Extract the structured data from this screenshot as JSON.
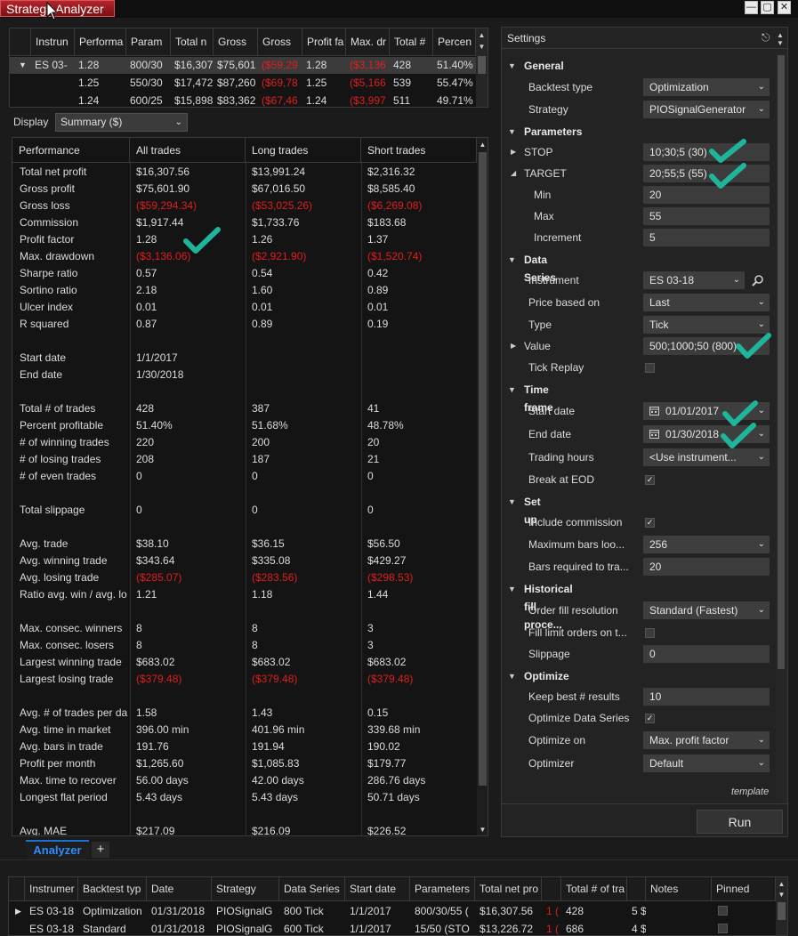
{
  "window": {
    "title": "Strategy Analyzer",
    "controls": [
      "minimize",
      "maximize",
      "close"
    ]
  },
  "top_grid": {
    "columns": [
      "Instrun",
      "Performa",
      "Param",
      "Total n",
      "Gross",
      "Gross",
      "Profit fa",
      "Max. dr",
      "Total #",
      "Percen"
    ],
    "rows": [
      {
        "instrument": "ES 03-",
        "perf": "1.28",
        "param": "800/30",
        "total_net": "$16,307",
        "gross_profit": "$75,601",
        "gross_loss": "($59,29",
        "profit_factor": "1.28",
        "max_dd": "($3,136",
        "total_trades": "428",
        "percent": "51.40%"
      },
      {
        "instrument": "",
        "perf": "1.25",
        "param": "550/30",
        "total_net": "$17,472",
        "gross_profit": "$87,260",
        "gross_loss": "($69,78",
        "profit_factor": "1.25",
        "max_dd": "($5,166",
        "total_trades": "539",
        "percent": "55.47%"
      },
      {
        "instrument": "",
        "perf": "1.24",
        "param": "600/25",
        "total_net": "$15,898",
        "gross_profit": "$83,362",
        "gross_loss": "($67,46",
        "profit_factor": "1.24",
        "max_dd": "($3,997",
        "total_trades": "511",
        "percent": "49.71%"
      }
    ]
  },
  "display": {
    "label": "Display",
    "selected": "Summary ($)"
  },
  "summary": {
    "headers": [
      "Performance",
      "All trades",
      "Long trades",
      "Short trades"
    ],
    "rows": [
      {
        "label": "Total net profit",
        "all": "$16,307.56",
        "long": "$13,991.24",
        "short": "$2,316.32",
        "neg": false
      },
      {
        "label": "Gross profit",
        "all": "$75,601.90",
        "long": "$67,016.50",
        "short": "$8,585.40",
        "neg": false
      },
      {
        "label": "Gross loss",
        "all": "($59,294.34)",
        "long": "($53,025.26)",
        "short": "($6,269.08)",
        "neg": true
      },
      {
        "label": "Commission",
        "all": "$1,917.44",
        "long": "$1,733.76",
        "short": "$183.68",
        "neg": false
      },
      {
        "label": "Profit factor",
        "all": "1.28",
        "long": "1.26",
        "short": "1.37",
        "neg": false
      },
      {
        "label": "Max. drawdown",
        "all": "($3,136.06)",
        "long": "($2,921.90)",
        "short": "($1,520.74)",
        "neg": true
      },
      {
        "label": "Sharpe ratio",
        "all": "0.57",
        "long": "0.54",
        "short": "0.42",
        "neg": false
      },
      {
        "label": "Sortino ratio",
        "all": "2.18",
        "long": "1.60",
        "short": "0.89",
        "neg": false
      },
      {
        "label": "Ulcer index",
        "all": "0.01",
        "long": "0.01",
        "short": "0.01",
        "neg": false
      },
      {
        "label": "R squared",
        "all": "0.87",
        "long": "0.89",
        "short": "0.19",
        "neg": false
      },
      {
        "label": "",
        "all": "",
        "long": "",
        "short": "",
        "neg": false
      },
      {
        "label": "Start date",
        "all": "1/1/2017",
        "long": "",
        "short": "",
        "neg": false
      },
      {
        "label": "End date",
        "all": "1/30/2018",
        "long": "",
        "short": "",
        "neg": false
      },
      {
        "label": "",
        "all": "",
        "long": "",
        "short": "",
        "neg": false
      },
      {
        "label": "Total # of trades",
        "all": "428",
        "long": "387",
        "short": "41",
        "neg": false
      },
      {
        "label": "Percent profitable",
        "all": "51.40%",
        "long": "51.68%",
        "short": "48.78%",
        "neg": false
      },
      {
        "label": "# of winning trades",
        "all": "220",
        "long": "200",
        "short": "20",
        "neg": false
      },
      {
        "label": "# of losing trades",
        "all": "208",
        "long": "187",
        "short": "21",
        "neg": false
      },
      {
        "label": "# of even trades",
        "all": "0",
        "long": "0",
        "short": "0",
        "neg": false
      },
      {
        "label": "",
        "all": "",
        "long": "",
        "short": "",
        "neg": false
      },
      {
        "label": "Total slippage",
        "all": "0",
        "long": "0",
        "short": "0",
        "neg": false
      },
      {
        "label": "",
        "all": "",
        "long": "",
        "short": "",
        "neg": false
      },
      {
        "label": "Avg. trade",
        "all": "$38.10",
        "long": "$36.15",
        "short": "$56.50",
        "neg": false
      },
      {
        "label": "Avg. winning trade",
        "all": "$343.64",
        "long": "$335.08",
        "short": "$429.27",
        "neg": false
      },
      {
        "label": "Avg. losing trade",
        "all": "($285.07)",
        "long": "($283.56)",
        "short": "($298.53)",
        "neg": true
      },
      {
        "label": "Ratio avg. win / avg. lo",
        "all": "1.21",
        "long": "1.18",
        "short": "1.44",
        "neg": false
      },
      {
        "label": "",
        "all": "",
        "long": "",
        "short": "",
        "neg": false
      },
      {
        "label": "Max. consec. winners",
        "all": "8",
        "long": "8",
        "short": "3",
        "neg": false
      },
      {
        "label": "Max. consec. losers",
        "all": "8",
        "long": "8",
        "short": "3",
        "neg": false
      },
      {
        "label": "Largest winning trade",
        "all": "$683.02",
        "long": "$683.02",
        "short": "$683.02",
        "neg": false
      },
      {
        "label": "Largest losing trade",
        "all": "($379.48)",
        "long": "($379.48)",
        "short": "($379.48)",
        "neg": true
      },
      {
        "label": "",
        "all": "",
        "long": "",
        "short": "",
        "neg": false
      },
      {
        "label": "Avg. # of trades per da",
        "all": "1.58",
        "long": "1.43",
        "short": "0.15",
        "neg": false
      },
      {
        "label": "Avg. time in market",
        "all": "396.00 min",
        "long": "401.96 min",
        "short": "339.68 min",
        "neg": false
      },
      {
        "label": "Avg. bars in trade",
        "all": "191.76",
        "long": "191.94",
        "short": "190.02",
        "neg": false
      },
      {
        "label": "Profit per month",
        "all": "$1,265.60",
        "long": "$1,085.83",
        "short": "$179.77",
        "neg": false
      },
      {
        "label": "Max. time to recover",
        "all": "56.00 days",
        "long": "42.00 days",
        "short": "286.76 days",
        "neg": false
      },
      {
        "label": "Longest flat period",
        "all": "5.43 days",
        "long": "5.43 days",
        "short": "50.71 days",
        "neg": false
      },
      {
        "label": "",
        "all": "",
        "long": "",
        "short": "",
        "neg": false
      },
      {
        "label": "Avg. MAE",
        "all": "$217.09",
        "long": "$216.09",
        "short": "$226.52",
        "neg": false
      }
    ]
  },
  "settings": {
    "title": "Settings",
    "template_link": "template",
    "run_label": "Run",
    "general": {
      "section": "General",
      "backtest_type_label": "Backtest type",
      "backtest_type": "Optimization",
      "strategy_label": "Strategy",
      "strategy": "PIOSignalGenerator"
    },
    "parameters": {
      "section": "Parameters",
      "stop_label": "STOP",
      "stop": "10;30;5 (30)",
      "target_label": "TARGET",
      "target": "20;55;5 (55)",
      "min_label": "Min",
      "min": "20",
      "max_label": "Max",
      "max": "55",
      "increment_label": "Increment",
      "increment": "5"
    },
    "data_series": {
      "section": "Data Series",
      "instrument_label": "Instrument",
      "instrument": "ES 03-18",
      "price_based_on_label": "Price based on",
      "price_based_on": "Last",
      "type_label": "Type",
      "type": "Tick",
      "value_label": "Value",
      "value": "500;1000;50 (800)",
      "tick_replay_label": "Tick Replay"
    },
    "time_frame": {
      "section": "Time frame",
      "start_date_label": "Start date",
      "start_date": "01/01/2017",
      "end_date_label": "End date",
      "end_date": "01/30/2018",
      "trading_hours_label": "Trading hours",
      "trading_hours": "<Use instrument...",
      "break_at_eod_label": "Break at EOD"
    },
    "set_up": {
      "section": "Set up",
      "include_commission_label": "Include commission",
      "max_bars_label": "Maximum bars loo...",
      "max_bars": "256",
      "bars_required_label": "Bars required to tra...",
      "bars_required": "20"
    },
    "historical_fill": {
      "section": "Historical fill proce...",
      "order_fill_label": "Order fill resolution",
      "order_fill": "Standard (Fastest)",
      "fill_limit_label": "Fill limit orders on t...",
      "slippage_label": "Slippage",
      "slippage": "0"
    },
    "optimize": {
      "section": "Optimize",
      "keep_best_label": "Keep best # results",
      "keep_best": "10",
      "optimize_ds_label": "Optimize Data Series",
      "optimize_on_label": "Optimize on",
      "optimize_on": "Max. profit factor",
      "optimizer_label": "Optimizer",
      "optimizer": "Default"
    }
  },
  "tabs": {
    "active": "Analyzer",
    "add": "+"
  },
  "bottom_grid": {
    "columns": [
      "Instrumer",
      "Backtest typ",
      "Date",
      "Strategy",
      "Data Series",
      "Start date",
      "Parameters",
      "Total net pro",
      "",
      "Total # of tra",
      "",
      "Notes",
      "Pinned"
    ],
    "rows": [
      {
        "instrument": "ES 03-18",
        "backtest": "Optimization",
        "date": "01/31/2018",
        "strategy": "PIOSignalG",
        "series": "800 Tick",
        "start": "1/1/2017",
        "params": "800/30/55 (",
        "net": "$16,307.56",
        "m1": "1 (",
        "trades": "428",
        "m2": "5 $"
      },
      {
        "instrument": "ES 03-18",
        "backtest": "Standard",
        "date": "01/31/2018",
        "strategy": "PIOSignalG",
        "series": "600 Tick",
        "start": "1/1/2017",
        "params": "15/50 (STO",
        "net": "$13,226.72",
        "m1": "1 (",
        "trades": "686",
        "m2": "4 $"
      }
    ]
  },
  "colors": {
    "accent": "#1e6fd0",
    "title_tab": "#9b1a21",
    "negative": "#e01e1e",
    "annotation_check": "#1fb59a"
  }
}
